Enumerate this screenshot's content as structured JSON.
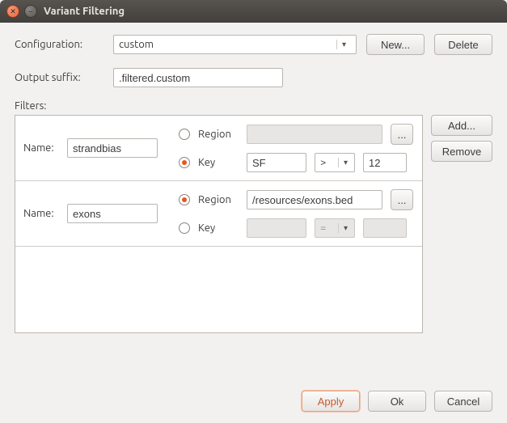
{
  "window": {
    "title": "Variant Filtering"
  },
  "labels": {
    "configuration": "Configuration:",
    "output_suffix": "Output suffix:",
    "filters": "Filters:",
    "name": "Name:",
    "region": "Region",
    "key": "Key",
    "browse": "...",
    "op_gt": ">",
    "op_eq": "="
  },
  "buttons": {
    "new": "New...",
    "delete": "Delete",
    "add": "Add...",
    "remove": "Remove",
    "apply": "Apply",
    "ok": "Ok",
    "cancel": "Cancel"
  },
  "config": {
    "selected": "custom",
    "output_suffix": ".filtered.custom"
  },
  "filters": [
    {
      "name": "strandbias",
      "mode": "key",
      "region_path": "",
      "key_field": "SF",
      "key_op": ">",
      "key_value": "12"
    },
    {
      "name": "exons",
      "mode": "region",
      "region_path": "/resources/exons.bed",
      "key_field": "",
      "key_op": "=",
      "key_value": ""
    }
  ]
}
